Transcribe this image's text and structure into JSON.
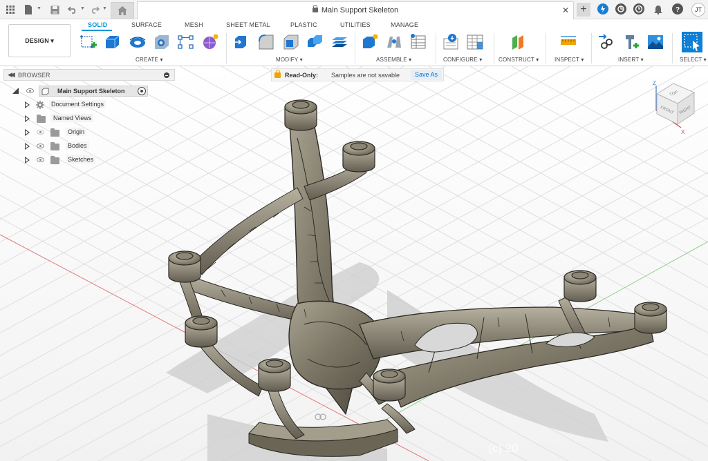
{
  "appbar": {
    "document_title": "Main Support Skeleton",
    "user_initials": "JT"
  },
  "ribbon": {
    "workspace_label": "DESIGN ▾",
    "tabs": [
      "SOLID",
      "SURFACE",
      "MESH",
      "SHEET METAL",
      "PLASTIC",
      "UTILITIES",
      "MANAGE"
    ],
    "active_tab": "SOLID",
    "groups": [
      "CREATE ▾",
      "MODIFY ▾",
      "ASSEMBLE ▾",
      "CONFIGURE ▾",
      "CONSTRUCT ▾",
      "INSPECT ▾",
      "INSERT ▾",
      "SELECT ▾"
    ]
  },
  "browser": {
    "title": "BROWSER",
    "root": "Main Support Skeleton",
    "items": [
      {
        "label": "Document Settings"
      },
      {
        "label": "Named Views"
      },
      {
        "label": "Origin"
      },
      {
        "label": "Bodies"
      },
      {
        "label": "Sketches"
      }
    ]
  },
  "readonly": {
    "label": "Read-Only:",
    "message": "Samples are not savable",
    "save_as": "Save As"
  },
  "viewcube": {
    "top": "TOP",
    "front": "FRONT",
    "right": "RIGHT",
    "axis_z": "Z",
    "axis_x": "X"
  },
  "viewport": {
    "watermark": "(c) 20"
  },
  "colors": {
    "accent": "#0696d7",
    "model": "#8a8474",
    "grid": "#dedede"
  }
}
